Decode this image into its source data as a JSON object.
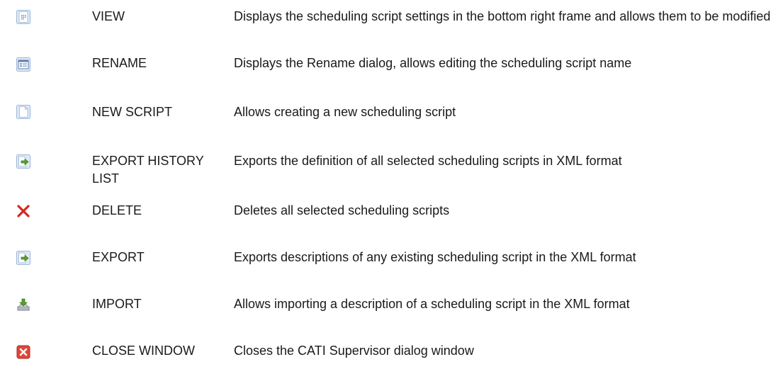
{
  "rows": [
    {
      "icon": "view-icon",
      "name": "VIEW",
      "description": "Displays the scheduling script settings in the bottom right frame and allows them to be modified"
    },
    {
      "icon": "rename-icon",
      "name": "RENAME",
      "description": "Displays the Rename dialog, allows editing the scheduling script name"
    },
    {
      "icon": "new-script-icon",
      "name": "NEW SCRIPT",
      "description": "Allows creating a new scheduling script"
    },
    {
      "icon": "export-history-icon",
      "name": "EXPORT HISTORY LIST",
      "description": "Exports the definition of all selected scheduling scripts in XML format"
    },
    {
      "icon": "delete-icon",
      "name": "DELETE",
      "description": "Deletes all selected scheduling scripts"
    },
    {
      "icon": "export-icon",
      "name": "EXPORT",
      "description": "Exports descriptions of any existing scheduling script in the XML format"
    },
    {
      "icon": "import-icon",
      "name": "IMPORT",
      "description": "Allows importing a description of a scheduling script in the XML format"
    },
    {
      "icon": "close-window-icon",
      "name": "CLOSE WINDOW",
      "description": "Closes the CATI Supervisor dialog window"
    }
  ],
  "colors": {
    "icon_frame": "#9bb7d9",
    "icon_fill": "#dfeaf7",
    "delete_red": "#d8281e",
    "export_green": "#5aa02c",
    "close_red": "#e0463a"
  }
}
